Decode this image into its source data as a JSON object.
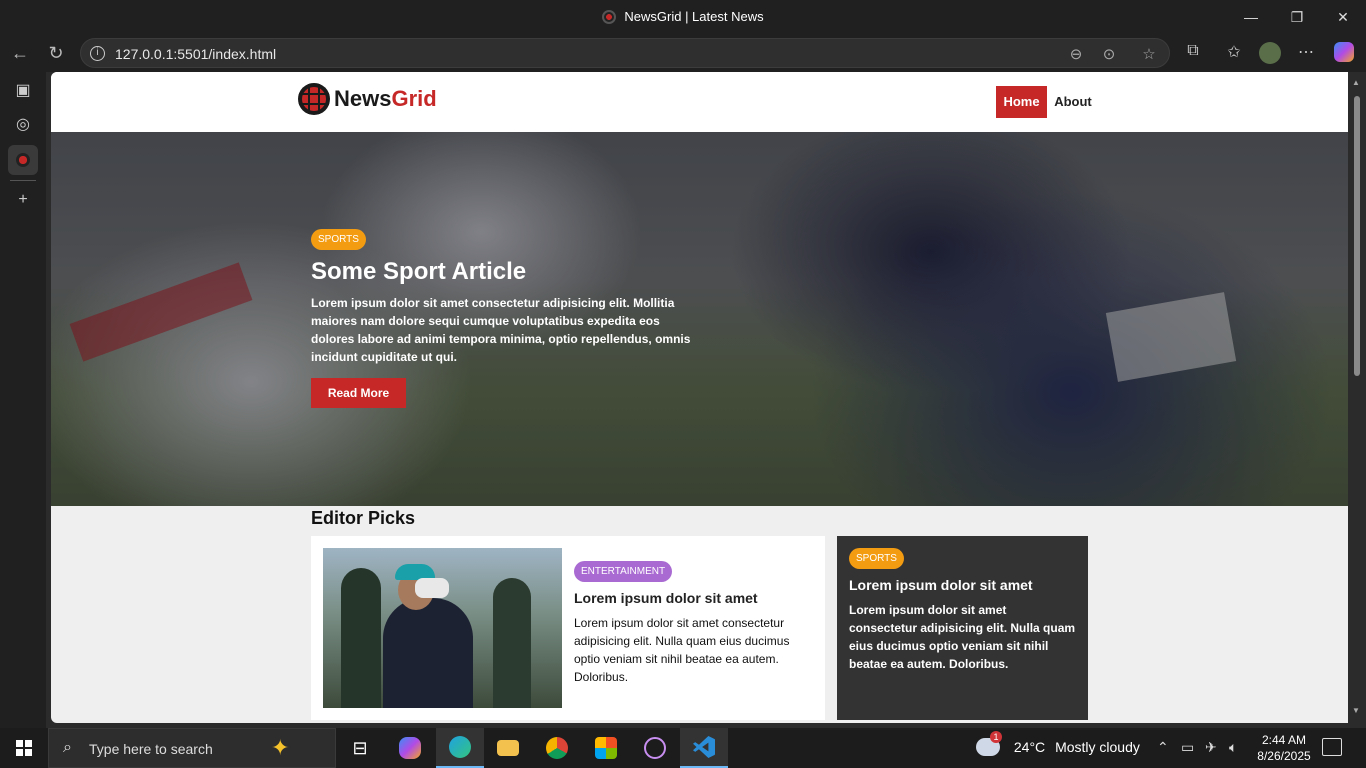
{
  "browser": {
    "window_title": "NewsGrid | Latest News",
    "url": "127.0.0.1:5501/index.html",
    "controls": {
      "minimize": "—",
      "restore": "❐",
      "close": "✕"
    },
    "nav_icons": [
      "back-icon",
      "refresh-icon"
    ],
    "toolbar_icons": [
      "zoom-out-icon",
      "reading-icon",
      "favorite-star-icon",
      "extensions-icon",
      "favorites-icon",
      "profile-avatar",
      "more-icon",
      "copilot-icon"
    ]
  },
  "sidebar": {
    "icons": [
      "tab-actions-icon",
      "globe-icon",
      "newsgrid-tab-icon",
      "add-tab-icon"
    ]
  },
  "site": {
    "logo_part1": "News",
    "logo_part2": "Grid",
    "nav": {
      "home": "Home",
      "about": "About"
    },
    "accent": "#c62828"
  },
  "hero": {
    "badge": "SPORTS",
    "title": "Some Sport Article",
    "text": "Lorem ipsum dolor sit amet consectetur adipisicing elit. Mollitia maiores nam dolore sequi cumque voluptatibus expedita eos dolores labore ad animi tempora minima, optio repellendus, omnis incidunt cupiditate ut qui.",
    "button": "Read More"
  },
  "editor_picks": {
    "heading": "Editor Picks",
    "main_card": {
      "badge": "ENTERTAINMENT",
      "title": "Lorem ipsum dolor sit amet",
      "text": "Lorem ipsum dolor sit amet consectetur adipisicing elit. Nulla quam eius ducimus optio veniam sit nihil beatae ea autem. Doloribus."
    },
    "side_card": {
      "badge": "SPORTS",
      "title": "Lorem ipsum dolor sit amet",
      "text": "Lorem ipsum dolor sit amet consectetur adipisicing elit. Nulla quam eius ducimus optio veniam sit nihil beatae ea autem. Doloribus."
    }
  },
  "taskbar": {
    "search_placeholder": "Type here to search",
    "weather_temp": "24°C",
    "weather_text": "Mostly cloudy",
    "weather_badge": "1",
    "time": "2:44 AM",
    "date": "8/26/2025",
    "apps": [
      "task-view-icon",
      "copilot-app-icon",
      "edge-icon",
      "file-explorer-icon",
      "chrome-icon",
      "store-icon",
      "media-player-icon",
      "vscode-icon"
    ]
  }
}
